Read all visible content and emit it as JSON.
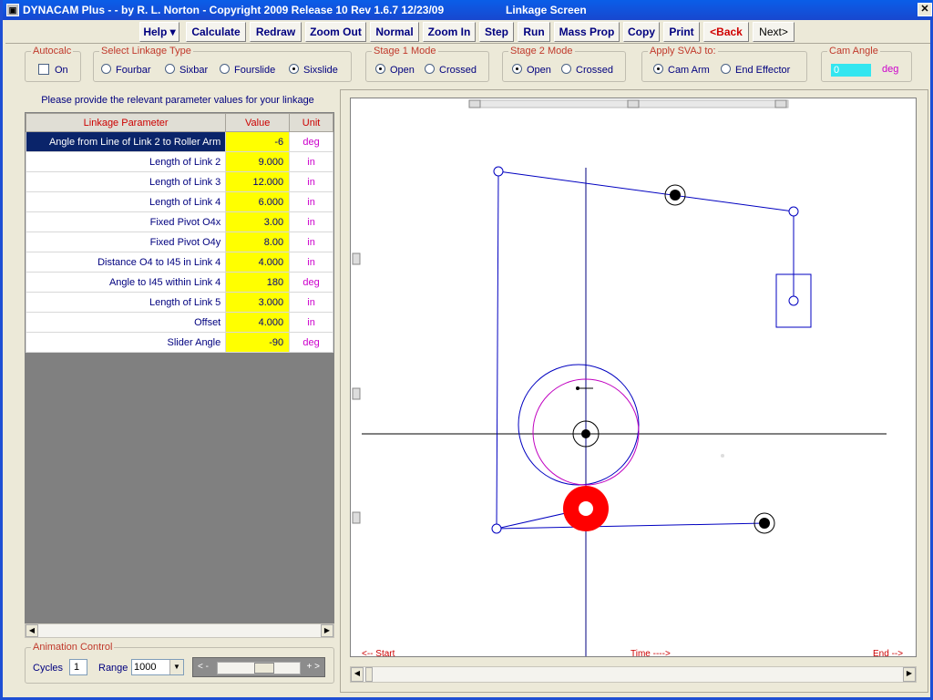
{
  "title": "DYNACAM Plus -  - by R. L. Norton - Copyright 2009 Release 10  Rev 1.6.7  12/23/09",
  "screen_name": "Linkage Screen",
  "menu": [
    "Help ▾",
    "Calculate",
    "Redraw",
    "Zoom Out",
    "Normal",
    "Zoom In",
    "Step",
    "Run",
    "Mass Prop",
    "Copy",
    "Print",
    "<Back",
    "Next>"
  ],
  "autocalc": {
    "label": "Autocalc",
    "option": "On",
    "checked": false
  },
  "linkage_type": {
    "label": "Select Linkage Type",
    "options": [
      "Fourbar",
      "Sixbar",
      "Fourslide",
      "Sixslide"
    ],
    "selected": "Sixslide"
  },
  "stage1": {
    "label": "Stage 1 Mode",
    "options": [
      "Open",
      "Crossed"
    ],
    "selected": "Open"
  },
  "stage2": {
    "label": "Stage 2 Mode",
    "options": [
      "Open",
      "Crossed"
    ],
    "selected": "Open"
  },
  "svaj": {
    "label": "Apply SVAJ to:",
    "options": [
      "Cam Arm",
      "End Effector"
    ],
    "selected": "Cam Arm"
  },
  "cam_angle": {
    "label": "Cam Angle",
    "value": "0",
    "unit": "deg"
  },
  "panel_heading": "Please provide the relevant parameter values for your linkage",
  "table": {
    "headers": [
      "Linkage Parameter",
      "Value",
      "Unit"
    ],
    "rows": [
      {
        "name": "Angle from Line of Link 2 to Roller Arm",
        "value": "-6",
        "unit": "deg"
      },
      {
        "name": "Length of Link 2",
        "value": "9.000",
        "unit": "in"
      },
      {
        "name": "Length of Link 3",
        "value": "12.000",
        "unit": "in"
      },
      {
        "name": "Length of Link 4",
        "value": "6.000",
        "unit": "in"
      },
      {
        "name": "Fixed Pivot O4x",
        "value": "3.00",
        "unit": "in"
      },
      {
        "name": "Fixed Pivot O4y",
        "value": "8.00",
        "unit": "in"
      },
      {
        "name": "Distance O4 to I45 in Link 4",
        "value": "4.000",
        "unit": "in"
      },
      {
        "name": "Angle to I45 within Link 4",
        "value": "180",
        "unit": "deg"
      },
      {
        "name": "Length of Link 5",
        "value": "3.000",
        "unit": "in"
      },
      {
        "name": "Offset",
        "value": "4.000",
        "unit": "in"
      },
      {
        "name": "Slider Angle",
        "value": "-90",
        "unit": "deg"
      }
    ]
  },
  "animation": {
    "label": "Animation Control",
    "cycles_label": "Cycles",
    "cycles": "1",
    "range_label": "Range",
    "range": "1000",
    "speed_left": "< -",
    "speed_right": "+ >"
  },
  "timeline": {
    "start": "<-- Start",
    "time": "Time ---->",
    "end": "End -->"
  },
  "colors": {
    "link": "#0000c0",
    "follower": "#ff0000",
    "cam_pitch": "#c000c0",
    "highlight": "#ffff00"
  }
}
